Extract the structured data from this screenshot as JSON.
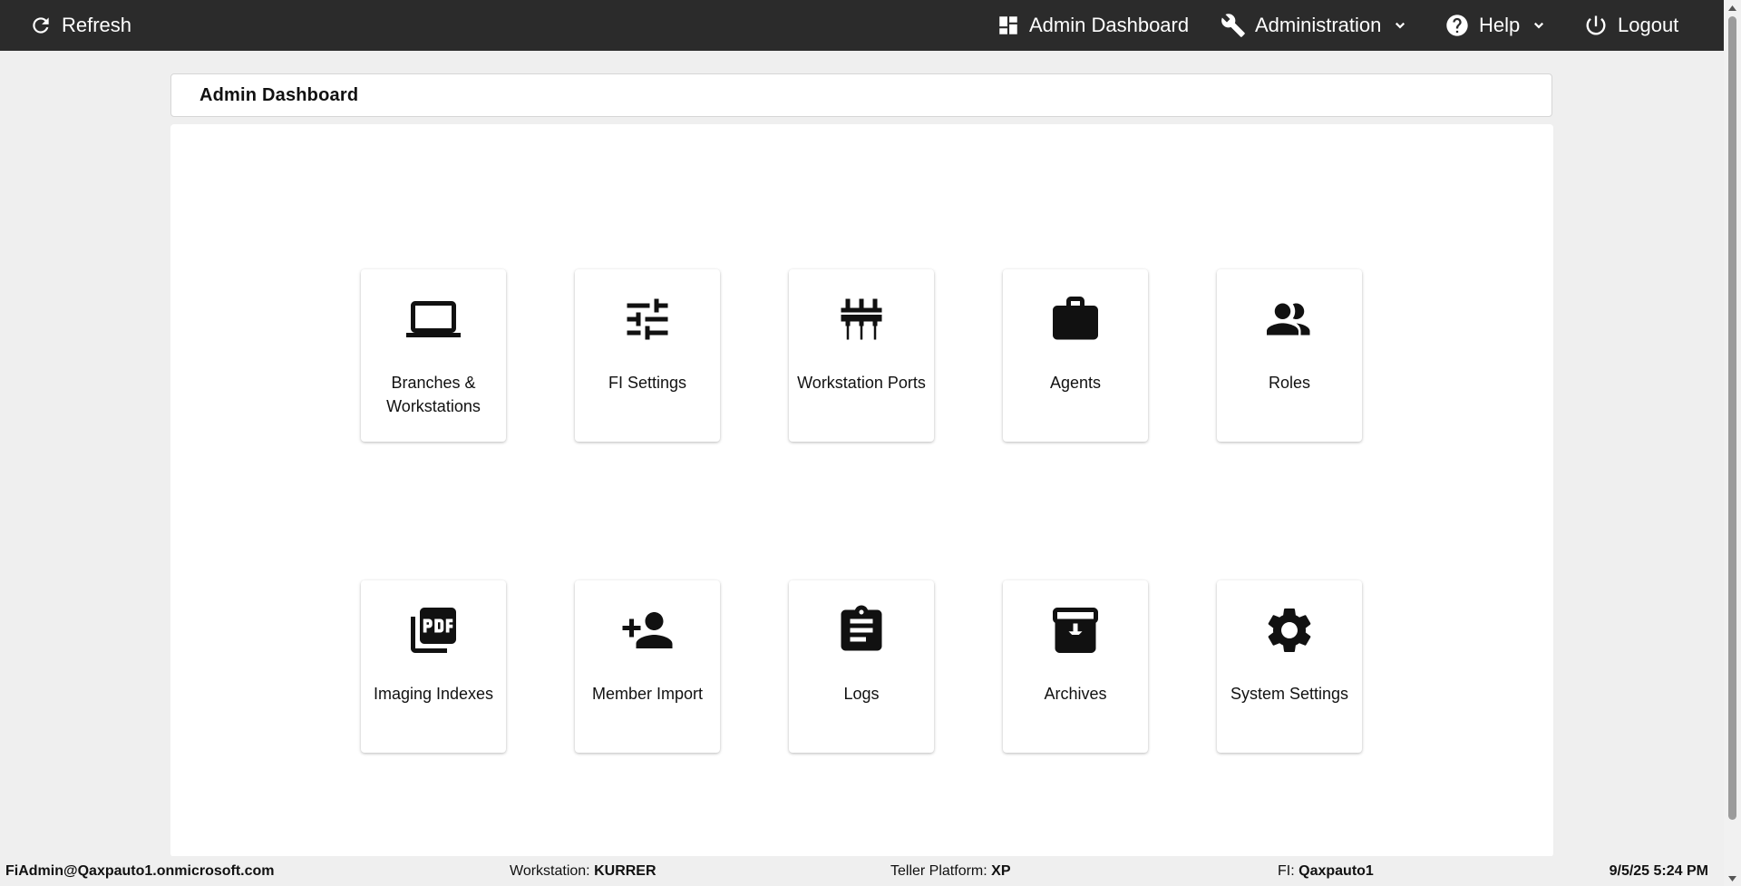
{
  "nav": {
    "refresh": {
      "label": "Refresh",
      "icon": "refresh-icon"
    },
    "admin_dashboard": {
      "label": "Admin Dashboard",
      "icon": "dashboard-icon"
    },
    "administration": {
      "label": "Administration",
      "icon": "wrench-icon"
    },
    "help": {
      "label": "Help",
      "icon": "help-circle-icon"
    },
    "logout": {
      "label": "Logout",
      "icon": "power-icon"
    }
  },
  "header": {
    "title": "Admin Dashboard"
  },
  "tiles": [
    {
      "label": "Branches & Workstations",
      "icon": "laptop-icon"
    },
    {
      "label": "FI Settings",
      "icon": "sliders-icon"
    },
    {
      "label": "Workstation Ports",
      "icon": "ports-icon"
    },
    {
      "label": "Agents",
      "icon": "briefcase-icon"
    },
    {
      "label": "Roles",
      "icon": "people-icon"
    },
    {
      "label": "Imaging Indexes",
      "icon": "pdf-icon"
    },
    {
      "label": "Member Import",
      "icon": "add-person-icon"
    },
    {
      "label": "Logs",
      "icon": "clipboard-icon"
    },
    {
      "label": "Archives",
      "icon": "archive-icon"
    },
    {
      "label": "System Settings",
      "icon": "gear-icon"
    }
  ],
  "footer": {
    "user": "FiAdmin@Qaxpauto1.onmicrosoft.com",
    "workstation_label": "Workstation:",
    "workstation_value": "KURRER",
    "platform_label": "Teller Platform:",
    "platform_value": "XP",
    "fi_label": "FI:",
    "fi_value": "Qaxpauto1",
    "datetime": "9/5/25 5:24 PM"
  },
  "colors": {
    "topbar": "#2b2b2b",
    "page_bg": "#efefef",
    "card_bg": "#ffffff",
    "icon": "#111111"
  }
}
